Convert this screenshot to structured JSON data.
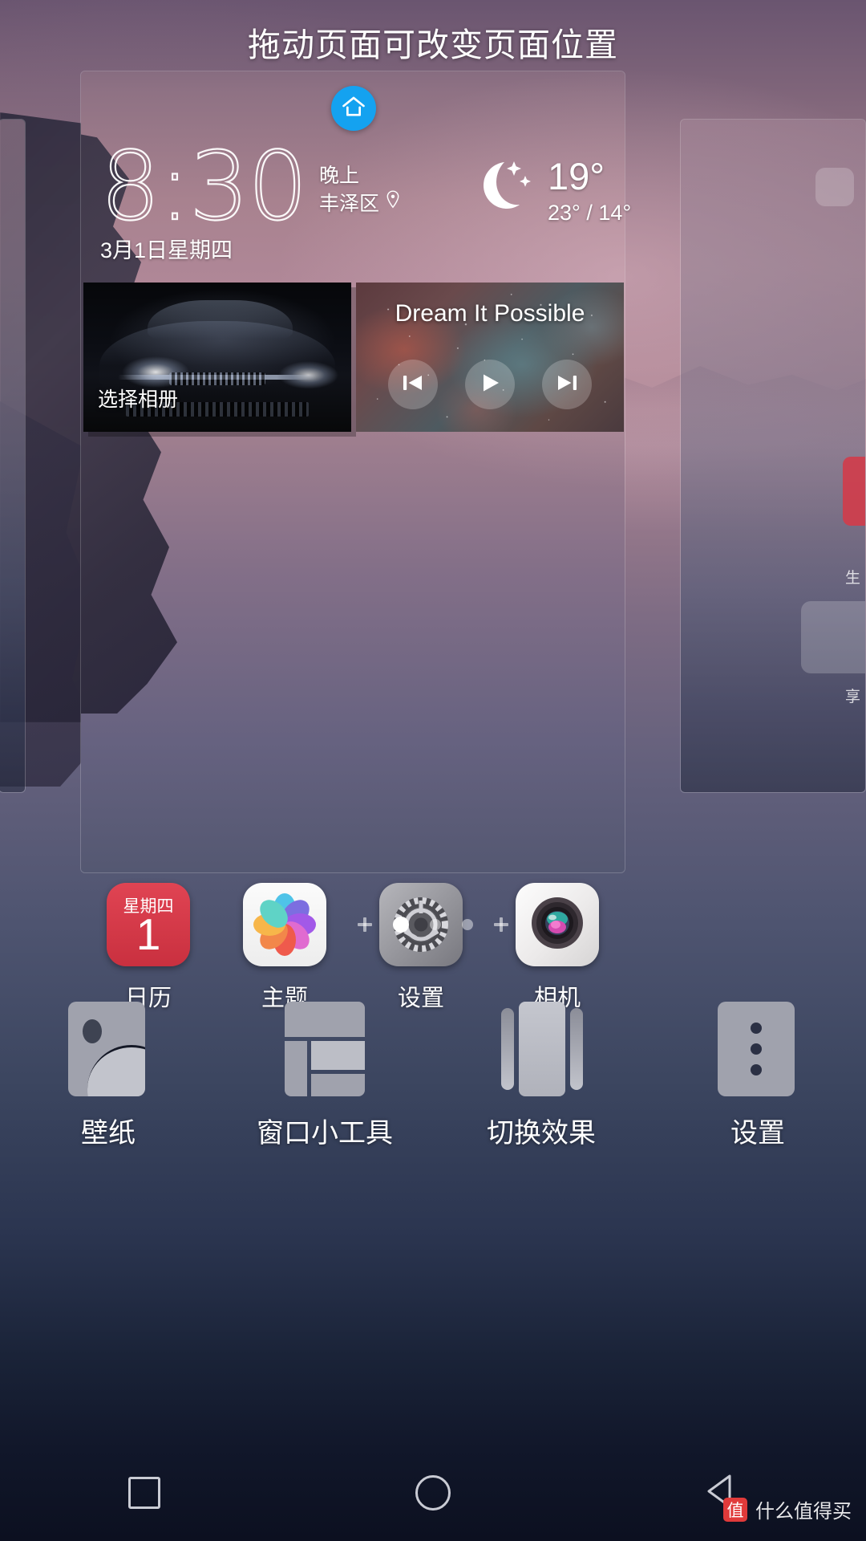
{
  "header": {
    "title": "拖动页面可改变页面位置"
  },
  "page_preview": {
    "home_badge_icon": "home-icon",
    "clock": {
      "time": "8:30",
      "period": "晚上",
      "location": "丰泽区",
      "location_icon": "location-pin-icon",
      "date": "3月1日星期四"
    },
    "weather": {
      "icon": "crescent-moon-stars-icon",
      "current_temp": "19°",
      "range": "23° / 14°"
    },
    "gallery_widget": {
      "label": "选择相册"
    },
    "music_widget": {
      "track_title": "Dream It Possible",
      "prev_icon": "skip-previous-icon",
      "play_icon": "play-icon",
      "next_icon": "skip-next-icon"
    },
    "dock": [
      {
        "label": "日历",
        "icon": "calendar-icon",
        "day_of_week": "星期四",
        "day": "1"
      },
      {
        "label": "主题",
        "icon": "themes-icon"
      },
      {
        "label": "设置",
        "icon": "settings-gear-icon"
      },
      {
        "label": "相机",
        "icon": "camera-icon"
      }
    ]
  },
  "side_pages": {
    "right_labels": [
      "生",
      "享"
    ]
  },
  "page_indicator": {
    "add_icon": "plus-icon",
    "dots": [
      "plus",
      "active",
      "inactive",
      "inactive",
      "plus"
    ],
    "active_index": 1
  },
  "toolbar": [
    {
      "label": "壁纸",
      "icon": "wallpaper-icon"
    },
    {
      "label": "窗口小工具",
      "icon": "widgets-icon"
    },
    {
      "label": "切换效果",
      "icon": "transition-effect-icon"
    },
    {
      "label": "设置",
      "icon": "more-settings-icon"
    }
  ],
  "navbar": [
    {
      "name": "recents",
      "icon": "square-icon"
    },
    {
      "name": "home",
      "icon": "circle-icon"
    },
    {
      "name": "back",
      "icon": "triangle-back-icon"
    }
  ],
  "watermark": {
    "badge": "值",
    "text": "什么值得买"
  },
  "colors": {
    "accent_blue": "#14a2f0",
    "calendar_red": "#d13c4a",
    "icon_gray": "#a0a2ad",
    "text_white": "#ffffff"
  }
}
